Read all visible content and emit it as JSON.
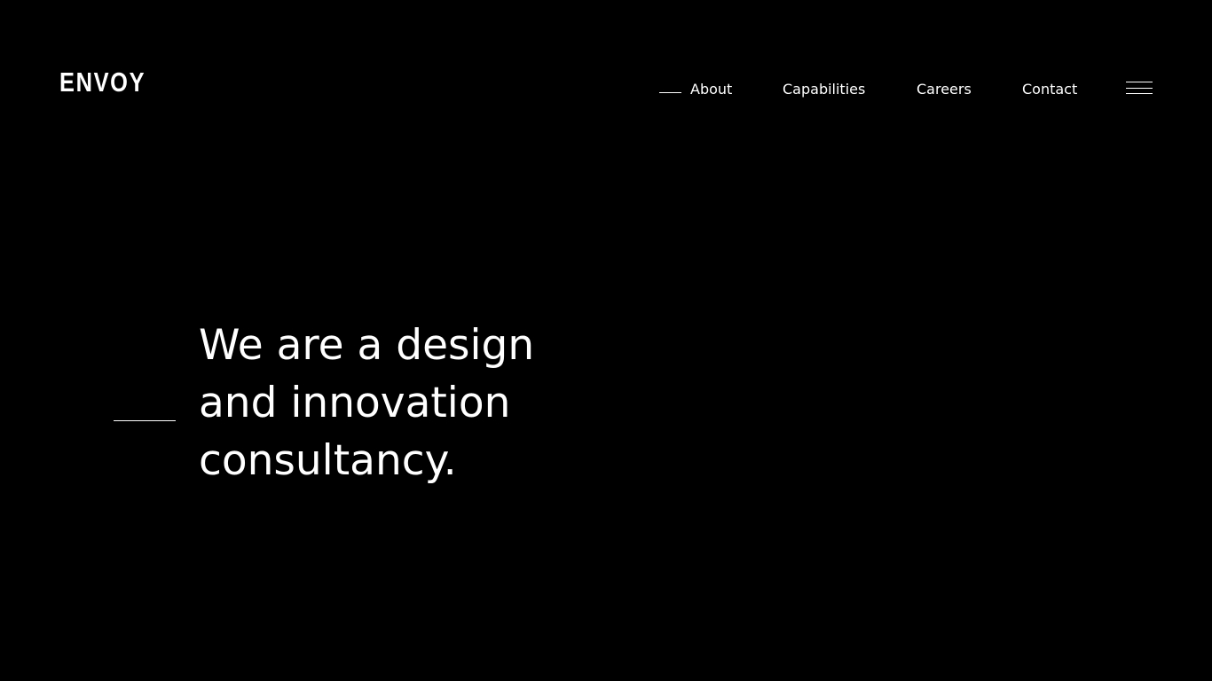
{
  "brand": {
    "logo_text": "ENVOY"
  },
  "nav": {
    "items": [
      {
        "label": "About",
        "active": true
      },
      {
        "label": "Capabilities",
        "active": false
      },
      {
        "label": "Careers",
        "active": false
      },
      {
        "label": "Contact",
        "active": false
      }
    ],
    "menu_icon": "hamburger-menu-icon"
  },
  "hero": {
    "lines": [
      "We are a design",
      "and innovation",
      "consultancy."
    ]
  },
  "colors": {
    "background": "#000000",
    "text": "#ffffff"
  }
}
